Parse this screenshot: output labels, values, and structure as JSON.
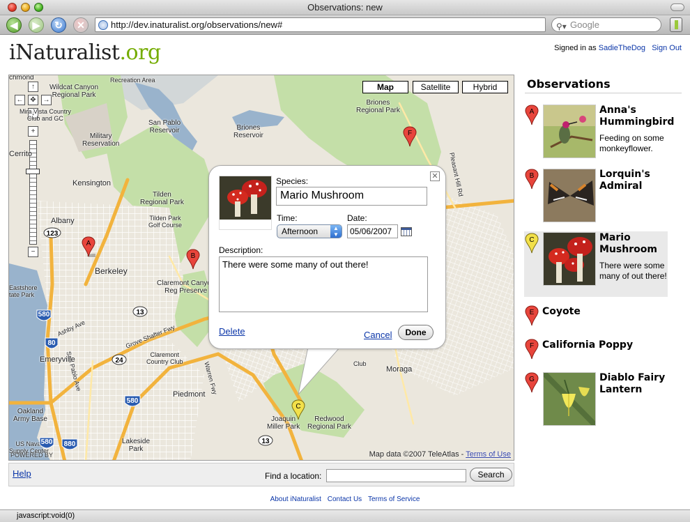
{
  "browser": {
    "title": "Observations: new",
    "url": "http://dev.inaturalist.org/observations/new#",
    "search_placeholder": "Google",
    "status": "javascript:void(0)"
  },
  "header": {
    "logo_main": "iNaturalist",
    "logo_suffix": ".org",
    "signed_in_prefix": "Signed in as",
    "username": "SadieTheDog",
    "sign_out": "Sign Out"
  },
  "map": {
    "types": [
      "Map",
      "Satellite",
      "Hybrid"
    ],
    "active_type": "Map",
    "copyright": "Map data ©2007 TeleAtlas -",
    "terms": "Terms of Use",
    "powered_by": "POWERED BY",
    "labels": {
      "richmond": "chmond",
      "wildcat": "Wildcat Canyon\nRegional Park",
      "mira_vista": "Mira Vista Country\nClub and GC",
      "military": "Military\nReservation",
      "el_cerrito": "Cerrito",
      "kensington": "Kensington",
      "albany": "Albany",
      "berkeley": "Berkeley",
      "tilden": "Tilden\nRegional Park",
      "tilden_golf": "Tilden Park\nGolf Course",
      "recreation": "Recreation Area",
      "san_pablo": "San Pablo\nReservoir",
      "briones_res": "Briones\nReservoir",
      "briones_park": "Briones\nRegional Park",
      "pleasant_hill": "Pleasant Hill Rd",
      "claremont_canyon": "Claremont Canyon\nReg Preserve",
      "eastshore": "Eastshore\ntate Park",
      "ashby": "Ashby Ave",
      "san_pablo_ave": "San Pablo Ave",
      "emeryville": "Emeryville",
      "grove_shafter": "Grove Shafter Fwy",
      "claremont_cc": "Claremont\nCountry Club",
      "warren": "Warren Fwy",
      "piedmont": "Piedmont",
      "oakland_army": "Oakland\nArmy Base",
      "us_naval": "US Naval\nSupply Center",
      "lakeside": "Lakeside\nPark",
      "joaquin": "Joaquin\nMiller Park",
      "redwood": "Redwood\nRegional Park",
      "moraga": "Moraga",
      "club": "Club"
    },
    "shields": {
      "i580a": "580",
      "i80": "80",
      "i580b": "580",
      "i880": "880",
      "r123": "123",
      "r13a": "13",
      "r13b": "13",
      "r24": "24"
    },
    "pins": [
      "A",
      "B",
      "C",
      "F"
    ]
  },
  "info_window": {
    "species_label": "Species:",
    "species_value": "Mario Mushroom",
    "time_label": "Time:",
    "time_value": "Afternoon",
    "date_label": "Date:",
    "date_value": "05/06/2007",
    "description_label": "Description:",
    "description_value": "There were some many of out there!",
    "delete": "Delete",
    "cancel": "Cancel",
    "done": "Done"
  },
  "map_footer": {
    "help": "Help",
    "find_label": "Find a location:",
    "search_button": "Search"
  },
  "page_footer": {
    "links": [
      "About iNaturalist",
      "Contact Us",
      "Terms of Service"
    ]
  },
  "sidebar": {
    "title": "Observations",
    "observations": [
      {
        "marker": "A",
        "name": "Anna's Hummingbird",
        "description": "Feeding on some monkeyflower.",
        "pin_color": "#e8453c"
      },
      {
        "marker": "B",
        "name": "Lorquin's Admiral",
        "description": "",
        "pin_color": "#e8453c"
      },
      {
        "marker": "C",
        "name": "Mario Mushroom",
        "description": "There were some many of out there!",
        "pin_color": "#f2e04a"
      },
      {
        "marker": "E",
        "name": "Coyote",
        "description": "",
        "pin_color": "#e8453c"
      },
      {
        "marker": "F",
        "name": "California Poppy",
        "description": "",
        "pin_color": "#e8453c"
      },
      {
        "marker": "G",
        "name": "Diablo Fairy Lantern",
        "description": "",
        "pin_color": "#e8453c"
      }
    ]
  }
}
